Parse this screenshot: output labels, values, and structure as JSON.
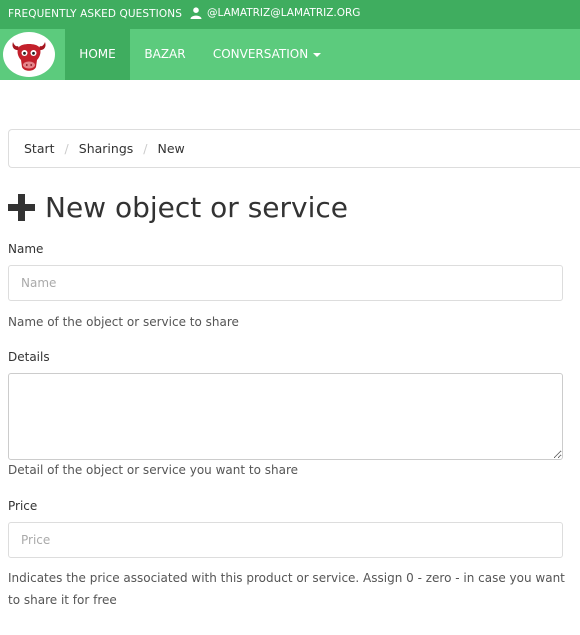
{
  "topbar": {
    "faq_label": "FREQUENTLY ASKED QUESTIONS",
    "user_email": "@LAMATRIZ@LAMATRIZ.ORG",
    "user_icon": "user-icon",
    "background_color": "#3fad5f"
  },
  "navbar": {
    "logo_icon": "bull-head-logo-icon",
    "items": [
      {
        "label": "HOME",
        "active": true
      },
      {
        "label": "BAZAR",
        "active": false
      },
      {
        "label": "CONVERSATION",
        "active": false,
        "dropdown": true
      }
    ],
    "background_color": "#5ccb7d",
    "active_color": "#3fad5f"
  },
  "breadcrumb": {
    "items": [
      "Start",
      "Sharings",
      "New"
    ],
    "separator": "/"
  },
  "page": {
    "title": "New object or service",
    "title_icon": "plus-icon"
  },
  "form": {
    "name": {
      "label": "Name",
      "placeholder": "Name",
      "value": "",
      "help": "Name of the object or service to share"
    },
    "details": {
      "label": "Details",
      "value": "",
      "help": "Detail of the object or service you want to share"
    },
    "price": {
      "label": "Price",
      "placeholder": "Price",
      "value": "",
      "help": "Indicates the price associated with this product or service. Assign 0 - zero - in case you want to share it for free"
    }
  }
}
